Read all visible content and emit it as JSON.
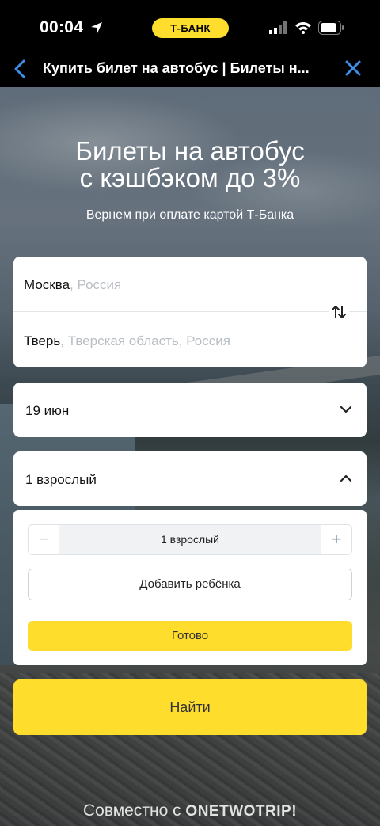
{
  "status_bar": {
    "time": "00:04",
    "bank_label": "Т‑БАНК"
  },
  "nav": {
    "title": "Купить билет на автобус | Билеты н..."
  },
  "hero": {
    "title_line1": "Билеты на автобус",
    "title_line2": "с кэшбэком до 3%",
    "subtitle": "Вернем при оплате картой Т-Банка"
  },
  "route": {
    "from_city": "Москва",
    "from_region": ", Россия",
    "to_city": "Тверь",
    "to_region": ", Тверская область, Россия"
  },
  "date": {
    "value": "19 июн"
  },
  "passengers": {
    "value": "1 взрослый",
    "stepper_minus": "−",
    "stepper_value": "1 взрослый",
    "stepper_plus": "+",
    "add_child_label": "Добавить ребёнка",
    "done_label": "Готово"
  },
  "search": {
    "label": "Найти"
  },
  "footer": {
    "prefix": "Совместно с ",
    "brand": "ONETWOTRIP!"
  },
  "colors": {
    "accent_yellow": "#ffdd2d",
    "nav_icon_blue": "#3d8ee8",
    "muted_text": "#b9bec4"
  }
}
